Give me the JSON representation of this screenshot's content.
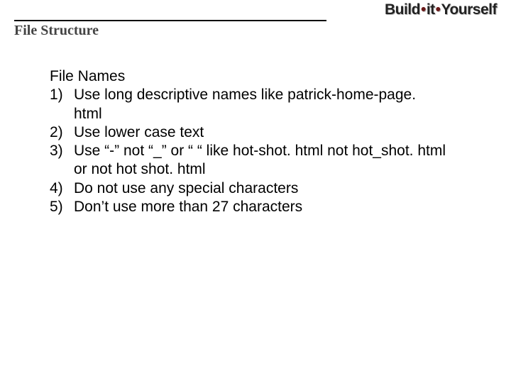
{
  "logo": {
    "part1": "Build",
    "part2": "it",
    "part3": "Yourself"
  },
  "page_title": "File Structure",
  "section_heading": "File Names",
  "rules": [
    {
      "num": "1)",
      "text": "Use long descriptive names like patrick-home-page. html"
    },
    {
      "num": "2)",
      "text": "Use lower case text"
    },
    {
      "num": "3)",
      "text": "Use “-” not “_” or “  “ like hot-shot. html not hot_shot. html or not hot shot. html"
    },
    {
      "num": "4)",
      "text": "Do not use any special characters"
    },
    {
      "num": "5)",
      "text": "Don’t use more than 27 characters"
    }
  ]
}
